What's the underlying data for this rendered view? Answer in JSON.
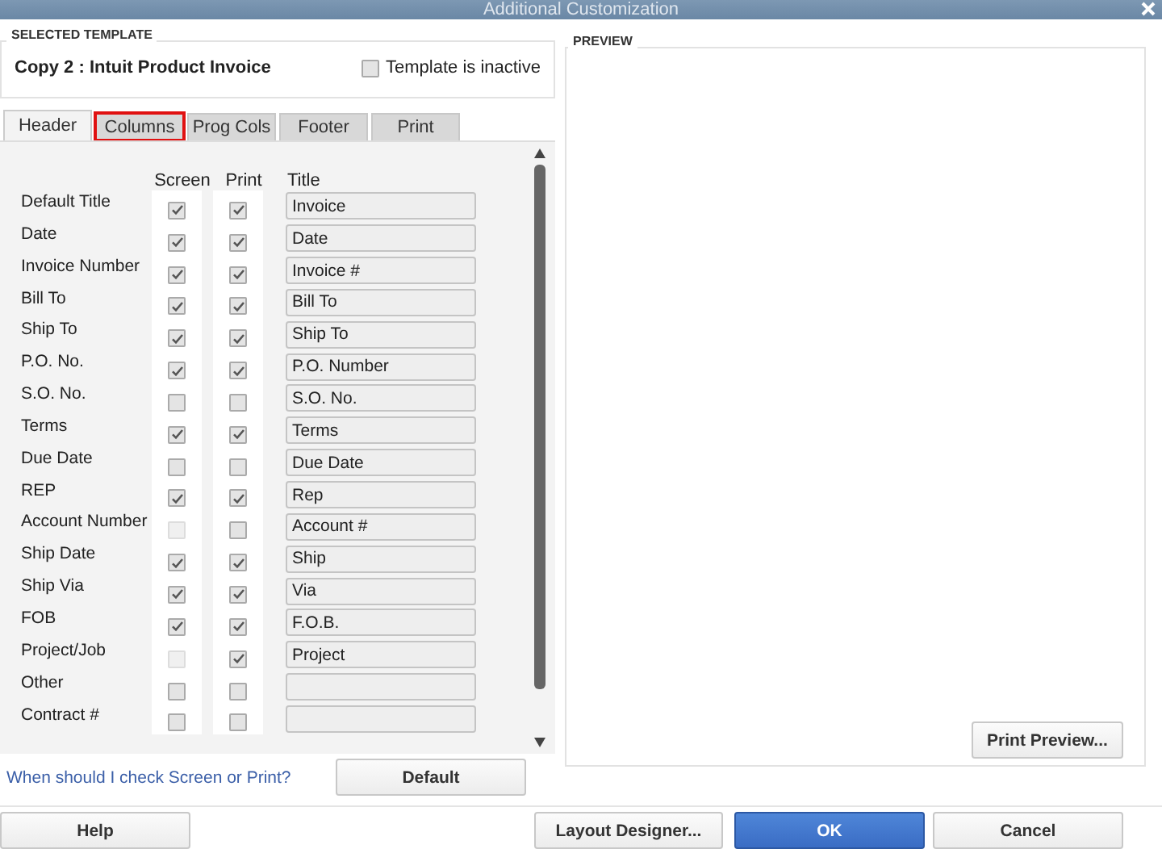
{
  "window": {
    "title": "Additional Customization"
  },
  "selected_template": {
    "heading": "SELECTED TEMPLATE",
    "name": "Copy 2 : Intuit Product Invoice",
    "inactive": {
      "label": "Template is inactive",
      "checked": false
    }
  },
  "tabs": [
    {
      "label": "Header",
      "selected": true,
      "outlined": false
    },
    {
      "label": "Columns",
      "selected": false,
      "outlined": true
    },
    {
      "label": "Prog Cols",
      "selected": false,
      "outlined": false
    },
    {
      "label": "Footer",
      "selected": false,
      "outlined": false
    },
    {
      "label": "Print",
      "selected": false,
      "outlined": false
    }
  ],
  "table": {
    "columns": [
      "Screen",
      "Print",
      "Title"
    ],
    "rows": [
      {
        "label": "Default Title",
        "screen": {
          "checked": true,
          "disabled": false
        },
        "print": {
          "checked": true,
          "disabled": false
        },
        "title": "Invoice"
      },
      {
        "label": "Date",
        "screen": {
          "checked": true,
          "disabled": false
        },
        "print": {
          "checked": true,
          "disabled": false
        },
        "title": "Date"
      },
      {
        "label": "Invoice Number",
        "screen": {
          "checked": true,
          "disabled": false
        },
        "print": {
          "checked": true,
          "disabled": false
        },
        "title": "Invoice #"
      },
      {
        "label": "Bill To",
        "screen": {
          "checked": true,
          "disabled": false
        },
        "print": {
          "checked": true,
          "disabled": false
        },
        "title": "Bill To"
      },
      {
        "label": "Ship To",
        "screen": {
          "checked": true,
          "disabled": false
        },
        "print": {
          "checked": true,
          "disabled": false
        },
        "title": "Ship To"
      },
      {
        "label": "P.O. No.",
        "screen": {
          "checked": true,
          "disabled": false
        },
        "print": {
          "checked": true,
          "disabled": false
        },
        "title": "P.O. Number"
      },
      {
        "label": "S.O. No.",
        "screen": {
          "checked": false,
          "disabled": false
        },
        "print": {
          "checked": false,
          "disabled": false
        },
        "title": "S.O. No."
      },
      {
        "label": "Terms",
        "screen": {
          "checked": true,
          "disabled": false
        },
        "print": {
          "checked": true,
          "disabled": false
        },
        "title": "Terms"
      },
      {
        "label": "Due Date",
        "screen": {
          "checked": false,
          "disabled": false
        },
        "print": {
          "checked": false,
          "disabled": false
        },
        "title": "Due Date"
      },
      {
        "label": "REP",
        "screen": {
          "checked": true,
          "disabled": false
        },
        "print": {
          "checked": true,
          "disabled": false
        },
        "title": "Rep"
      },
      {
        "label": "Account Number",
        "screen": {
          "checked": false,
          "disabled": true
        },
        "print": {
          "checked": false,
          "disabled": false
        },
        "title": "Account #"
      },
      {
        "label": "Ship Date",
        "screen": {
          "checked": true,
          "disabled": false
        },
        "print": {
          "checked": true,
          "disabled": false
        },
        "title": "Ship"
      },
      {
        "label": "Ship Via",
        "screen": {
          "checked": true,
          "disabled": false
        },
        "print": {
          "checked": true,
          "disabled": false
        },
        "title": "Via"
      },
      {
        "label": "FOB",
        "screen": {
          "checked": true,
          "disabled": false
        },
        "print": {
          "checked": true,
          "disabled": false
        },
        "title": "F.O.B."
      },
      {
        "label": "Project/Job",
        "screen": {
          "checked": false,
          "disabled": true
        },
        "print": {
          "checked": true,
          "disabled": false
        },
        "title": "Project"
      },
      {
        "label": "Other",
        "screen": {
          "checked": false,
          "disabled": false
        },
        "print": {
          "checked": false,
          "disabled": false
        }
      },
      {
        "label": "Contract #",
        "screen": {
          "checked": false,
          "disabled": false
        },
        "print": {
          "checked": false,
          "disabled": false
        }
      }
    ]
  },
  "help_link": "When should I check Screen or Print?",
  "default_button": "Default",
  "preview": {
    "heading": "PREVIEW",
    "button": "Print Preview..."
  },
  "buttons": [
    {
      "label": "Help",
      "kind": "normal"
    },
    {
      "label": "Layout Designer...",
      "kind": "normal"
    },
    {
      "label": "OK",
      "kind": "primary"
    },
    {
      "label": "Cancel",
      "kind": "normal"
    }
  ]
}
